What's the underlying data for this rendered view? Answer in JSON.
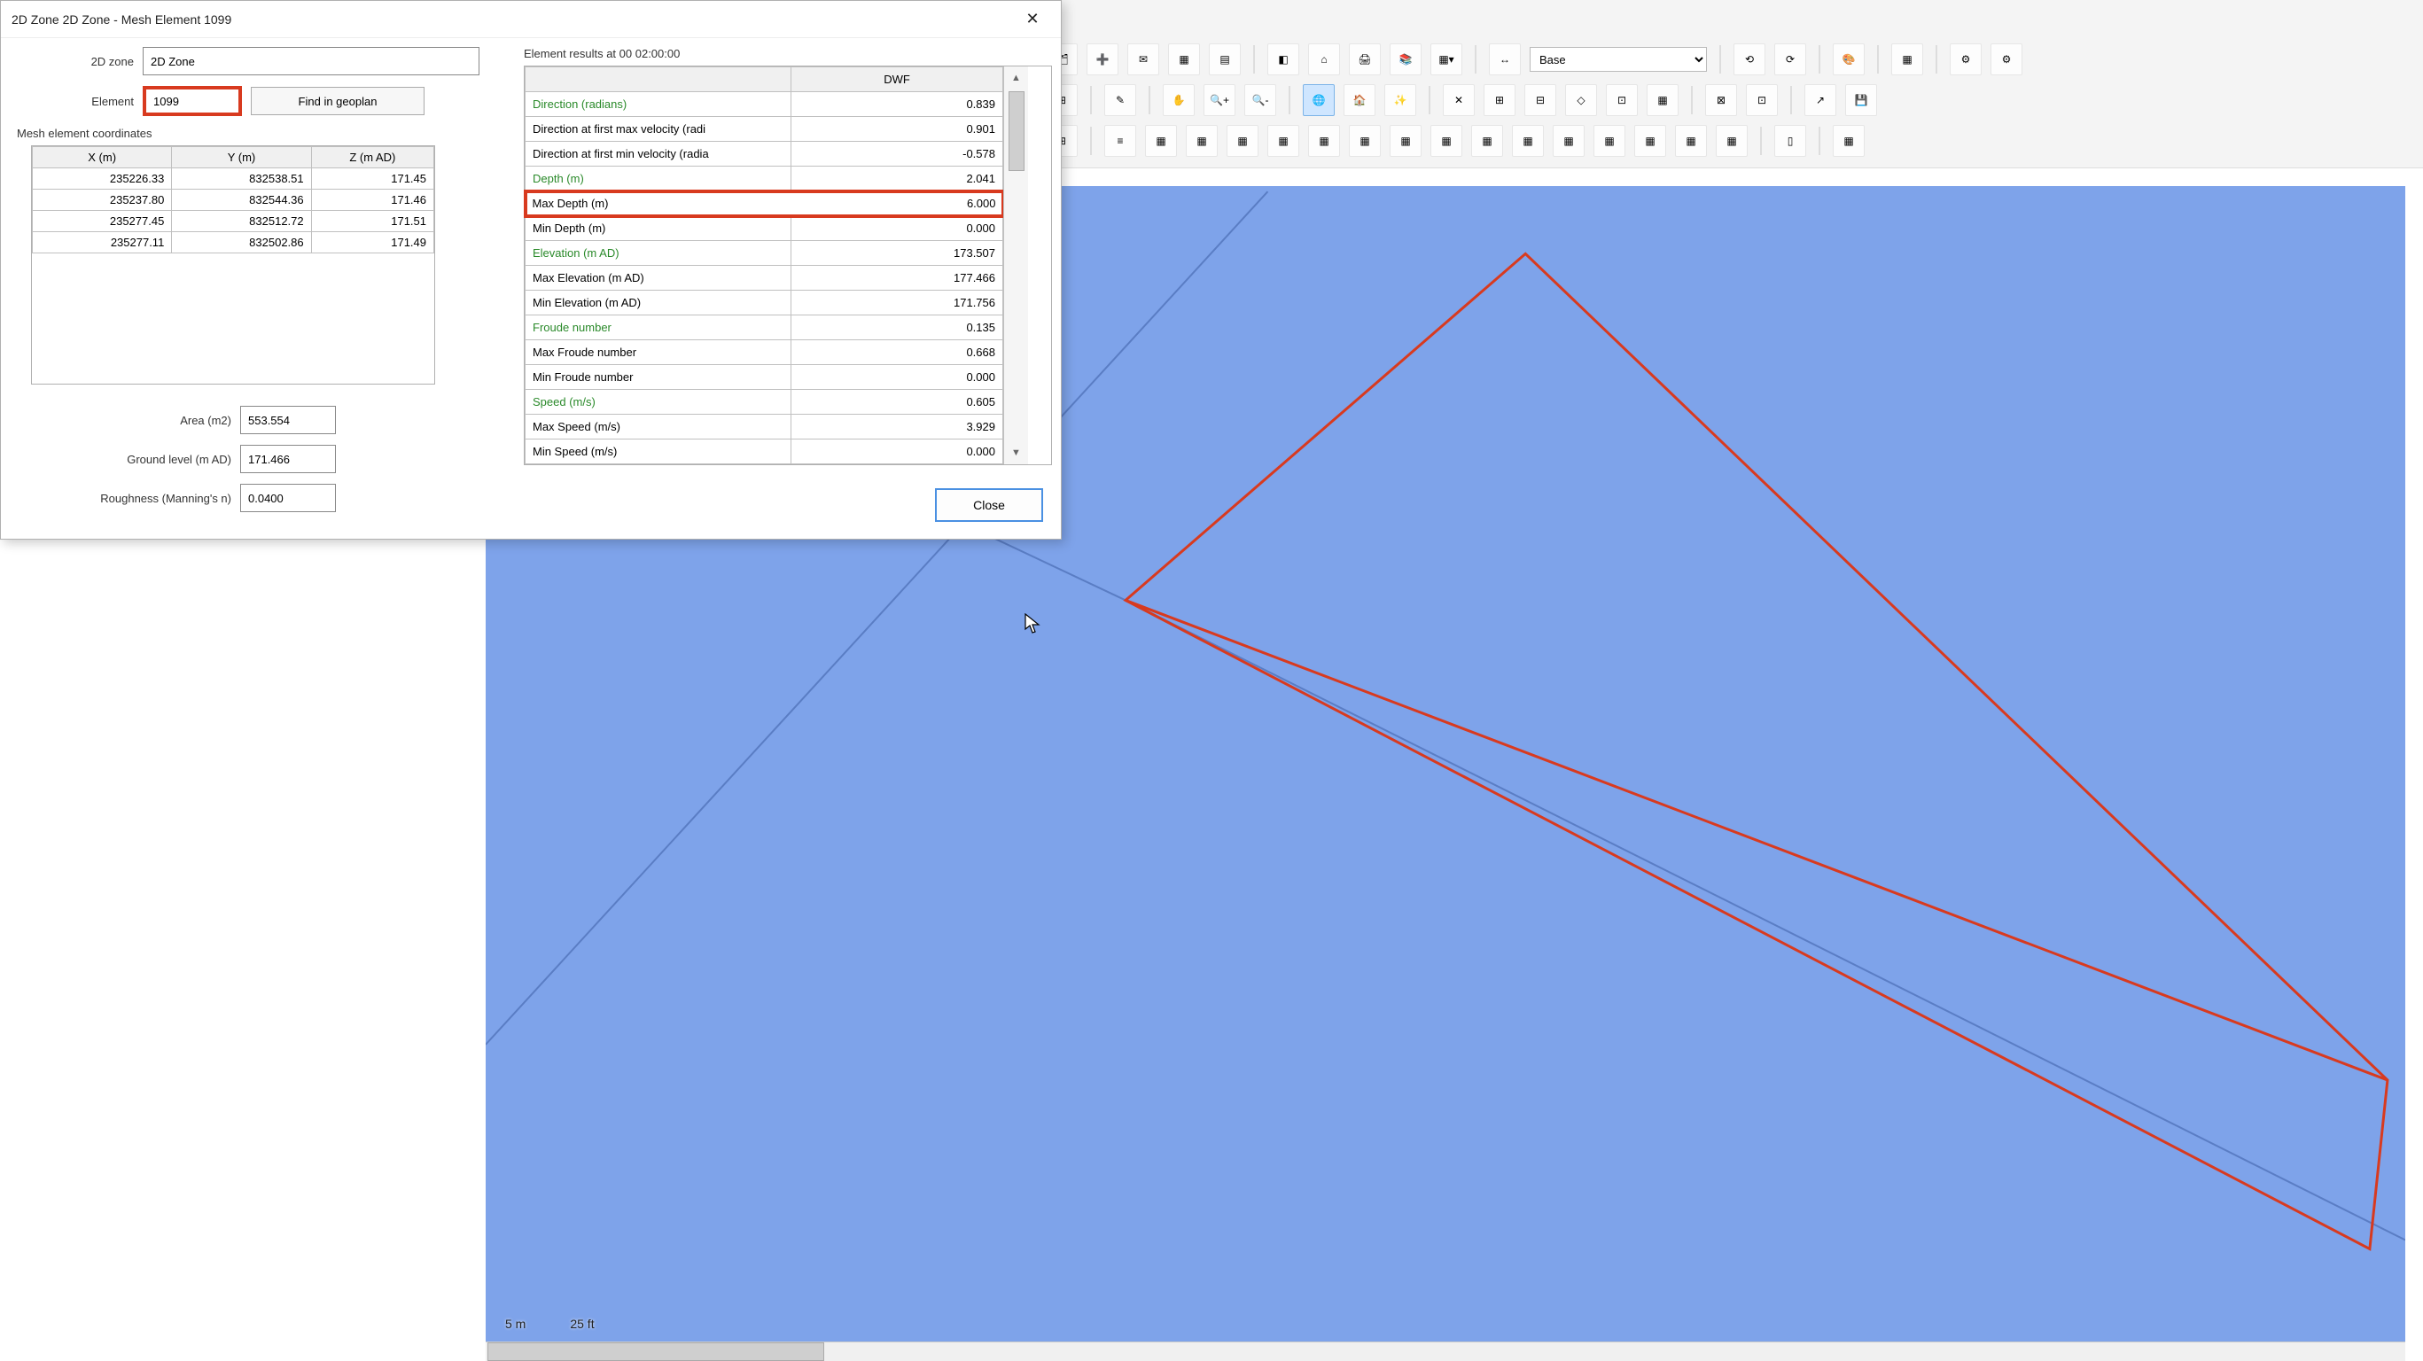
{
  "dialog": {
    "title": "2D Zone 2D Zone - Mesh Element 1099",
    "zone_label": "2D zone",
    "zone_value": "2D Zone",
    "element_label": "Element",
    "element_value": "1099",
    "find_button": "Find in geoplan",
    "coord_section": "Mesh element coordinates",
    "coord_headers": {
      "x": "X (m)",
      "y": "Y (m)",
      "z": "Z (m AD)"
    },
    "coord_rows": [
      {
        "x": "235226.33",
        "y": "832538.51",
        "z": "171.45"
      },
      {
        "x": "235237.80",
        "y": "832544.36",
        "z": "171.46"
      },
      {
        "x": "235277.45",
        "y": "832512.72",
        "z": "171.51"
      },
      {
        "x": "235277.11",
        "y": "832502.86",
        "z": "171.49"
      }
    ],
    "area_label": "Area (m2)",
    "area_value": "553.554",
    "ground_label": "Ground level (m AD)",
    "ground_value": "171.466",
    "roughness_label": "Roughness (Manning's n)",
    "roughness_value": "0.0400"
  },
  "results": {
    "header": "Element results at 00 02:00:00",
    "column": "DWF",
    "rows": [
      {
        "label": "Direction (radians)",
        "value": "0.839",
        "green": true
      },
      {
        "label": "Direction at first max velocity (radi",
        "value": "0.901"
      },
      {
        "label": "Direction at first min velocity (radia",
        "value": "-0.578"
      },
      {
        "label": "Depth (m)",
        "value": "2.041",
        "green": true
      },
      {
        "label": "Max Depth (m)",
        "value": "6.000",
        "highlight": true
      },
      {
        "label": "Min Depth (m)",
        "value": "0.000"
      },
      {
        "label": "Elevation (m AD)",
        "value": "173.507",
        "green": true
      },
      {
        "label": "Max Elevation (m AD)",
        "value": "177.466"
      },
      {
        "label": "Min Elevation (m AD)",
        "value": "171.756"
      },
      {
        "label": "Froude number",
        "value": "0.135",
        "green": true
      },
      {
        "label": "Max Froude number",
        "value": "0.668"
      },
      {
        "label": "Min Froude number",
        "value": "0.000"
      },
      {
        "label": "Speed (m/s)",
        "value": "0.605",
        "green": true
      },
      {
        "label": "Max Speed (m/s)",
        "value": "3.929"
      },
      {
        "label": "Min Speed (m/s)",
        "value": "0.000"
      }
    ],
    "close_button": "Close"
  },
  "toolbar": {
    "layer_select": "Base"
  },
  "scale": {
    "left": "5 m",
    "right": "25 ft"
  }
}
